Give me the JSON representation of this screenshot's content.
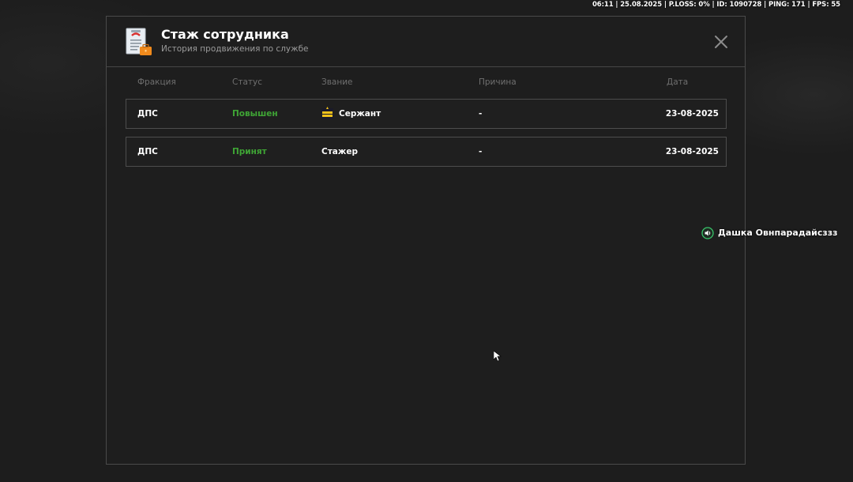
{
  "status_bar": {
    "text": "06:11 | 25.08.2025 | P.LOSS: 0% | ID: 1090728 | PING: 171 | FPS: 55"
  },
  "modal": {
    "title": "Стаж сотрудника",
    "subtitle": "История продвижения по службе",
    "icon": "document-briefcase-icon",
    "close_icon": "close-icon"
  },
  "table": {
    "headers": {
      "faction": "Фракция",
      "status": "Статус",
      "rank": "Звание",
      "reason": "Причина",
      "date": "Дата"
    },
    "rows": [
      {
        "faction": "ДПС",
        "status": "Повышен",
        "rank": "Сержант",
        "rank_icon": "sergeant-chevron-icon",
        "reason": "-",
        "date": "23-08-2025"
      },
      {
        "faction": "ДПС",
        "status": "Принят",
        "rank": "Стажер",
        "reason": "-",
        "date": "23-08-2025"
      }
    ]
  },
  "voice_chat": {
    "speaker_name": "Дашка Овнпарадайсззз",
    "icon": "speaker-icon"
  },
  "colors": {
    "status_green": "#3fa535",
    "background": "#1e1e1e",
    "border": "#4d4d4d",
    "header_text": "#6f6f6f"
  }
}
